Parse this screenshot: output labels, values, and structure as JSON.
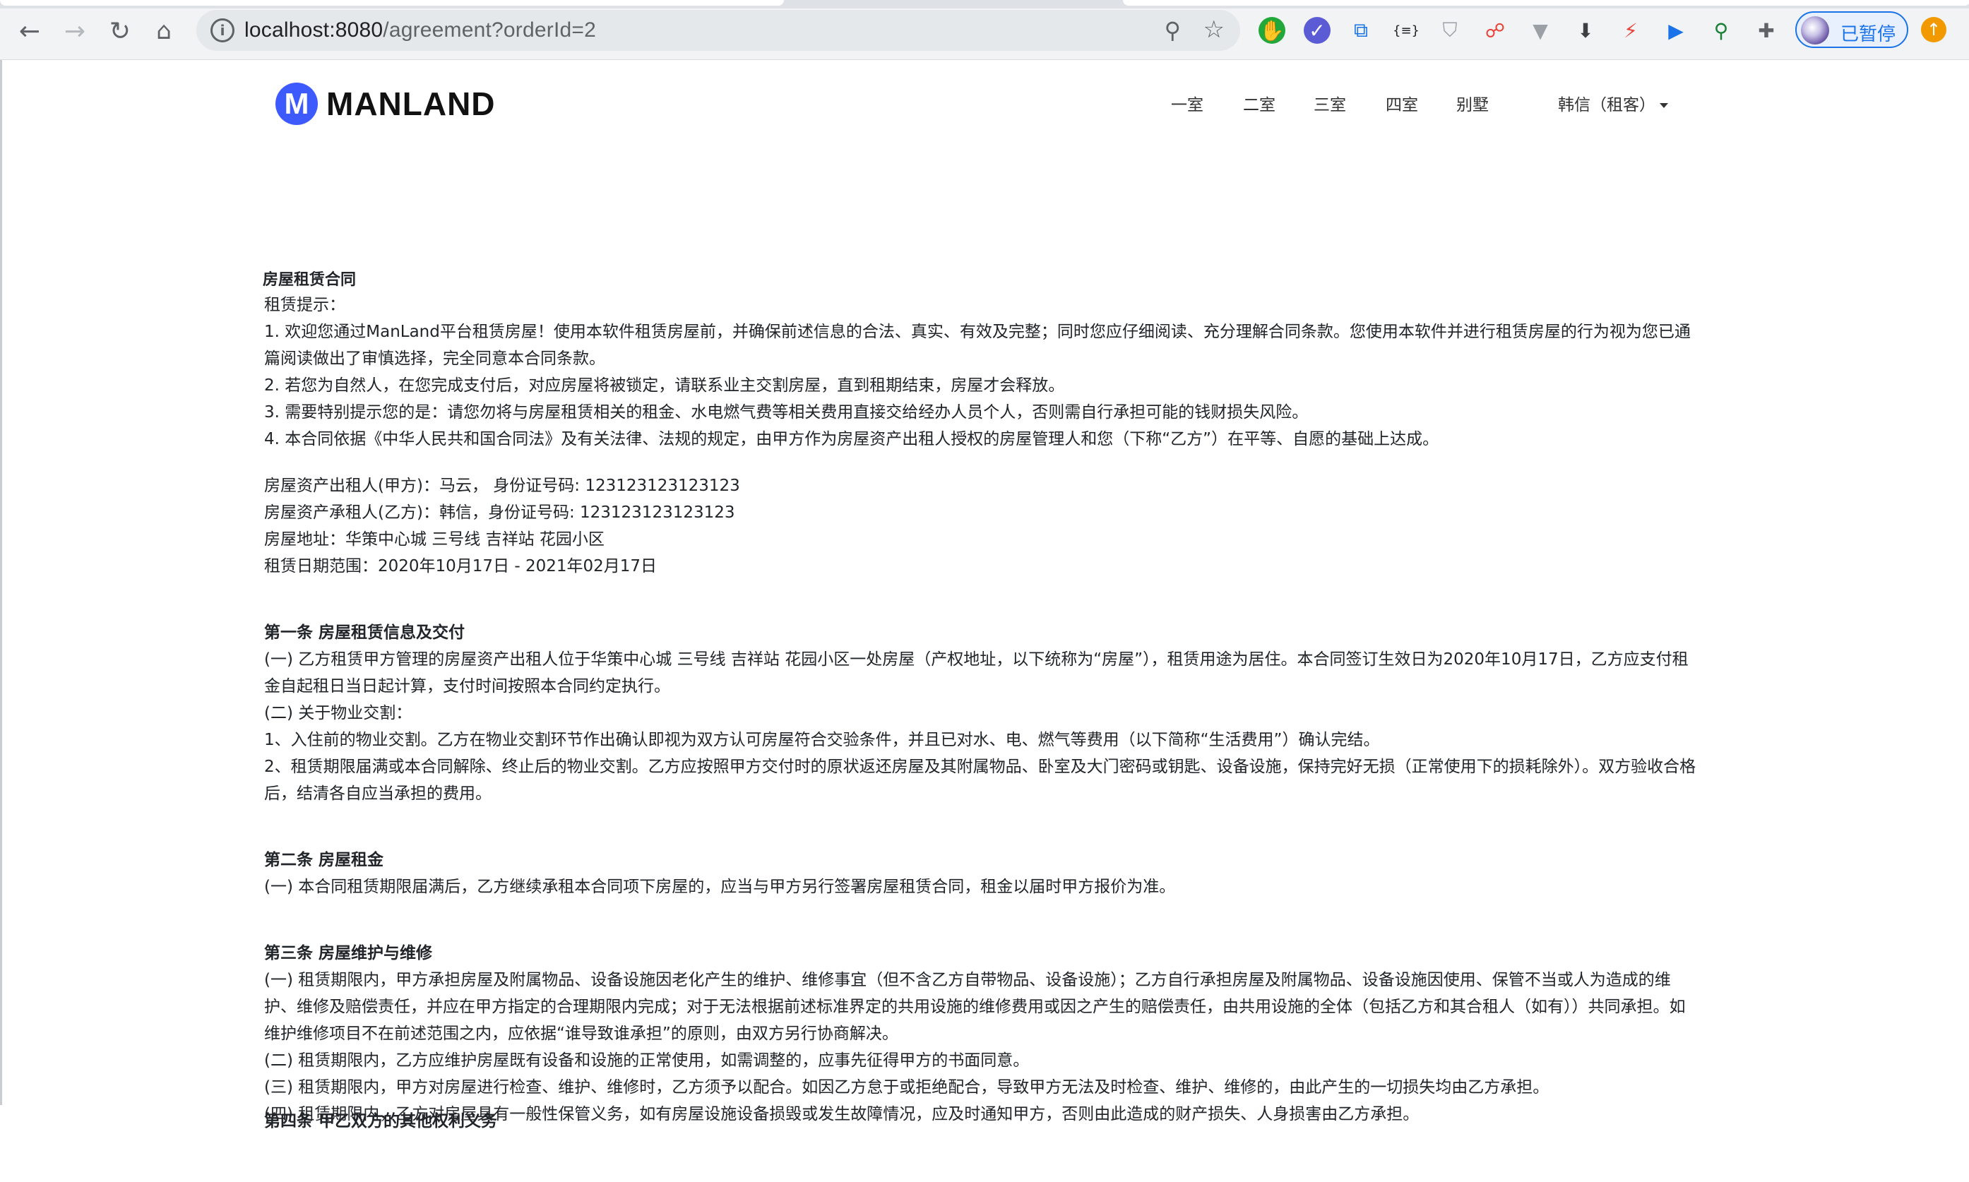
{
  "browser": {
    "url_host": "localhost:8080",
    "url_path": "/agreement?orderId=2",
    "profile_label": "已暂停",
    "extensions": [
      {
        "name": "green-hand-extension-icon",
        "glyph": "✋",
        "color": "#ffffff",
        "bg": "#22a83a"
      },
      {
        "name": "purple-check-extension-icon",
        "glyph": "✓",
        "color": "#ffffff",
        "bg": "#5b5bd6"
      },
      {
        "name": "translate-extension-icon",
        "glyph": "⧉",
        "color": "#1a73e8",
        "bg": "transparent"
      },
      {
        "name": "json-extension-icon",
        "glyph": "{≡}",
        "color": "#202124",
        "bg": "transparent"
      },
      {
        "name": "shield-extension-icon",
        "glyph": "⛉",
        "color": "#9aa0a6",
        "bg": "transparent"
      },
      {
        "name": "network-extension-icon",
        "glyph": "☍",
        "color": "#e8453c",
        "bg": "transparent"
      },
      {
        "name": "vue-extension-icon",
        "glyph": "▼",
        "color": "#9aa0a6",
        "bg": "transparent"
      },
      {
        "name": "download-extension-icon",
        "glyph": "⬇",
        "color": "#3c4043",
        "bg": "transparent"
      },
      {
        "name": "lightning-extension-icon",
        "glyph": "⚡",
        "color": "#e8453c",
        "bg": "transparent"
      },
      {
        "name": "video-extension-icon",
        "glyph": "▶",
        "color": "#1a73e8",
        "bg": "transparent"
      },
      {
        "name": "tag-extension-icon",
        "glyph": "⚲",
        "color": "#188038",
        "bg": "transparent"
      },
      {
        "name": "puzzle-extensions-icon",
        "glyph": "✚",
        "color": "#5f6368",
        "bg": "transparent"
      }
    ]
  },
  "site": {
    "logo_letter": "M",
    "logo_text": "MANLAND",
    "nav": [
      "一室",
      "二室",
      "三室",
      "四室",
      "别墅"
    ],
    "user_menu": "韩信（租客）"
  },
  "agreement": {
    "title": "房屋租赁合同",
    "tips_heading": "租赁提示：",
    "tips": [
      "1. 欢迎您通过ManLand平台租赁房屋！使用本软件租赁房屋前，并确保前述信息的合法、真实、有效及完整；同时您应仔细阅读、充分理解合同条款。您使用本软件并进行租赁房屋的行为视为您已通篇阅读做出了审慎选择，完全同意本合同条款。",
      "2. 若您为自然人，在您完成支付后，对应房屋将被锁定，请联系业主交割房屋，直到租期结束，房屋才会释放。",
      "3. 需要特别提示您的是：请您勿将与房屋租赁相关的租金、水电燃气费等相关费用直接交给经办人员个人，否则需自行承担可能的钱财损失风险。",
      "4. 本合同依据《中华人民共和国合同法》及有关法律、法规的规定，由甲方作为房屋资产出租人授权的房屋管理人和您（下称“乙方”）在平等、自愿的基础上达成。"
    ],
    "parties": [
      "房屋资产出租人(甲方)：马云， 身份证号码: 123123123123123",
      "房屋资产承租人(乙方)：韩信，身份证号码: 123123123123123",
      "房屋地址：华策中心城 三号线 吉祥站 花园小区",
      "租赁日期范围：2020年10月17日 - 2021年02月17日"
    ],
    "sections": [
      {
        "heading": "第一条 房屋租赁信息及交付",
        "lines": [
          "(一) 乙方租赁甲方管理的房屋资产出租人位于华策中心城 三号线 吉祥站 花园小区一处房屋（产权地址，以下统称为“房屋”），租赁用途为居住。本合同签订生效日为2020年10月17日，乙方应支付租金自起租日当日起计算，支付时间按照本合同约定执行。",
          "(二) 关于物业交割：",
          "1、入住前的物业交割。乙方在物业交割环节作出确认即视为双方认可房屋符合交验条件，并且已对水、电、燃气等费用（以下简称“生活费用”）确认完结。",
          "2、租赁期限届满或本合同解除、终止后的物业交割。乙方应按照甲方交付时的原状返还房屋及其附属物品、卧室及大门密码或钥匙、设备设施，保持完好无损（正常使用下的损耗除外）。双方验收合格后，结清各自应当承担的费用。"
        ]
      },
      {
        "heading": "第二条 房屋租金",
        "lines": [
          "(一) 本合同租赁期限届满后，乙方继续承租本合同项下房屋的，应当与甲方另行签署房屋租赁合同，租金以届时甲方报价为准。"
        ]
      },
      {
        "heading": "第三条 房屋维护与维修",
        "lines": [
          "(一) 租赁期限内，甲方承担房屋及附属物品、设备设施因老化产生的维护、维修事宜（但不含乙方自带物品、设备设施）；乙方自行承担房屋及附属物品、设备设施因使用、保管不当或人为造成的维护、维修及赔偿责任，并应在甲方指定的合理期限内完成；对于无法根据前述标准界定的共用设施的维修费用或因之产生的赔偿责任，由共用设施的全体（包括乙方和其合租人（如有））共同承担。如维护维修项目不在前述范围之内，应依据“谁导致谁承担”的原则，由双方另行协商解决。",
          "(二) 租赁期限内，乙方应维护房屋既有设备和设施的正常使用，如需调整的，应事先征得甲方的书面同意。",
          "(三) 租赁期限内，甲方对房屋进行检查、维护、维修时，乙方须予以配合。如因乙方怠于或拒绝配合，导致甲方无法及时检查、维护、维修的，由此产生的一切损失均由乙方承担。",
          "(四) 租赁期限内，乙方对房屋具有一般性保管义务，如有房屋设施设备损毁或发生故障情况，应及时通知甲方，否则由此造成的财产损失、人身损害由乙方承担。"
        ]
      }
    ],
    "next_section_heading": "第四条 甲乙双方的其他权利义务"
  }
}
